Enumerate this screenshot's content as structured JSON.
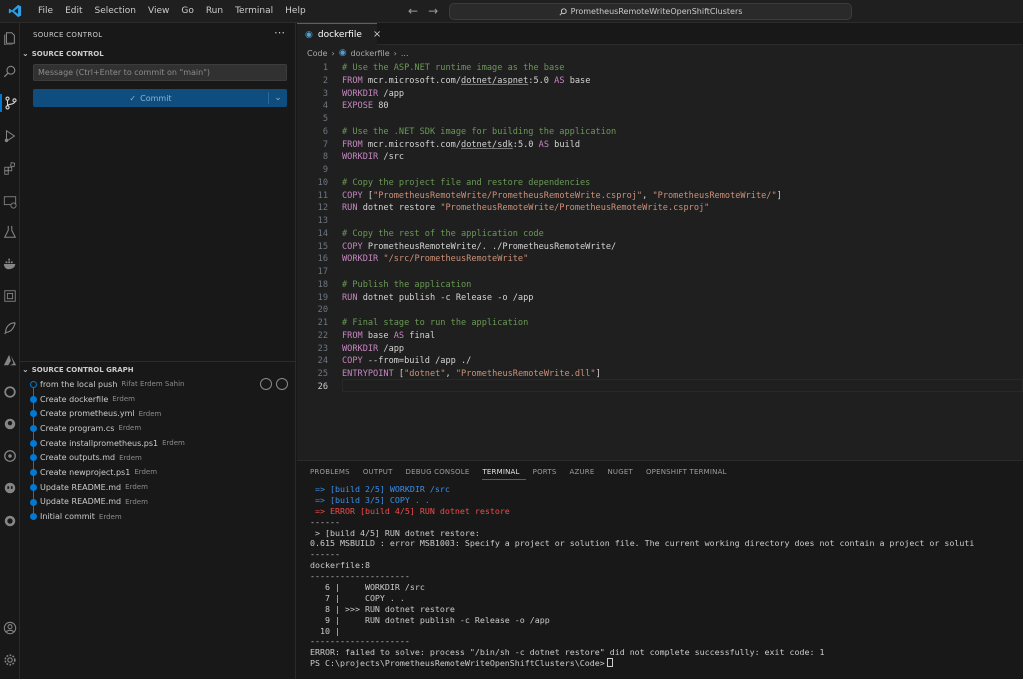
{
  "menu": [
    "File",
    "Edit",
    "Selection",
    "View",
    "Go",
    "Run",
    "Terminal",
    "Help"
  ],
  "command_center": {
    "text": "PrometheusRemoteWriteOpenShiftClusters"
  },
  "sidebar": {
    "title": "SOURCE CONTROL",
    "section": "SOURCE CONTROL",
    "message_placeholder": "Message (Ctrl+Enter to commit on \"main\")",
    "commit_label": "Commit",
    "graph_title": "SOURCE CONTROL GRAPH",
    "graph": [
      {
        "message": "from the local push",
        "author": "Rifat Erdem Sahin"
      },
      {
        "message": "Create dockerfile",
        "author": "Erdem"
      },
      {
        "message": "Create prometheus.yml",
        "author": "Erdem"
      },
      {
        "message": "Create program.cs",
        "author": "Erdem"
      },
      {
        "message": "Create installprometheus.ps1",
        "author": "Erdem"
      },
      {
        "message": "Create outputs.md",
        "author": "Erdem"
      },
      {
        "message": "Create newproject.ps1",
        "author": "Erdem"
      },
      {
        "message": "Update README.md",
        "author": "Erdem"
      },
      {
        "message": "Update README.md",
        "author": "Erdem"
      },
      {
        "message": "Initial commit",
        "author": "Erdem"
      }
    ]
  },
  "editor": {
    "tab_label": "dockerfile",
    "breadcrumb": [
      "Code",
      "dockerfile",
      "..."
    ],
    "lines": [
      {
        "n": "1",
        "parts": [
          [
            "c",
            "# Use the ASP.NET runtime image as the base"
          ]
        ]
      },
      {
        "n": "2",
        "parts": [
          [
            "k",
            "FROM "
          ],
          [
            "t",
            "mcr.microsoft.com/"
          ],
          [
            "u",
            "dotnet/aspnet"
          ],
          [
            "t",
            ":5.0 "
          ],
          [
            "k",
            "AS "
          ],
          [
            "t",
            "base"
          ]
        ]
      },
      {
        "n": "3",
        "parts": [
          [
            "k",
            "WORKDIR "
          ],
          [
            "t",
            "/app"
          ]
        ]
      },
      {
        "n": "4",
        "parts": [
          [
            "k",
            "EXPOSE "
          ],
          [
            "t",
            "80"
          ]
        ]
      },
      {
        "n": "5",
        "parts": []
      },
      {
        "n": "6",
        "parts": [
          [
            "c",
            "# Use the .NET SDK image for building the application"
          ]
        ]
      },
      {
        "n": "7",
        "parts": [
          [
            "k",
            "FROM "
          ],
          [
            "t",
            "mcr.microsoft.com/"
          ],
          [
            "u",
            "dotnet/sdk"
          ],
          [
            "t",
            ":5.0 "
          ],
          [
            "k",
            "AS "
          ],
          [
            "t",
            "build"
          ]
        ]
      },
      {
        "n": "8",
        "parts": [
          [
            "k",
            "WORKDIR "
          ],
          [
            "t",
            "/src"
          ]
        ]
      },
      {
        "n": "9",
        "parts": []
      },
      {
        "n": "10",
        "parts": [
          [
            "c",
            "# Copy the project file and restore dependencies"
          ]
        ]
      },
      {
        "n": "11",
        "parts": [
          [
            "k",
            "COPY "
          ],
          [
            "t",
            "["
          ],
          [
            "s",
            "\"PrometheusRemoteWrite/PrometheusRemoteWrite.csproj\""
          ],
          [
            "t",
            ", "
          ],
          [
            "s",
            "\"PrometheusRemoteWrite/\""
          ],
          [
            "t",
            "]"
          ]
        ]
      },
      {
        "n": "12",
        "parts": [
          [
            "k",
            "RUN "
          ],
          [
            "t",
            "dotnet restore "
          ],
          [
            "s",
            "\"PrometheusRemoteWrite/PrometheusRemoteWrite.csproj\""
          ]
        ]
      },
      {
        "n": "13",
        "parts": []
      },
      {
        "n": "14",
        "parts": [
          [
            "c",
            "# Copy the rest of the application code"
          ]
        ]
      },
      {
        "n": "15",
        "parts": [
          [
            "k",
            "COPY "
          ],
          [
            "t",
            "PrometheusRemoteWrite/. ./PrometheusRemoteWrite/"
          ]
        ]
      },
      {
        "n": "16",
        "parts": [
          [
            "k",
            "WORKDIR "
          ],
          [
            "s",
            "\"/src/PrometheusRemoteWrite\""
          ]
        ]
      },
      {
        "n": "17",
        "parts": []
      },
      {
        "n": "18",
        "parts": [
          [
            "c",
            "# Publish the application"
          ]
        ]
      },
      {
        "n": "19",
        "parts": [
          [
            "k",
            "RUN "
          ],
          [
            "t",
            "dotnet publish -c Release -o /app"
          ]
        ]
      },
      {
        "n": "20",
        "parts": []
      },
      {
        "n": "21",
        "parts": [
          [
            "c",
            "# Final stage to run the application"
          ]
        ]
      },
      {
        "n": "22",
        "parts": [
          [
            "k",
            "FROM "
          ],
          [
            "t",
            "base "
          ],
          [
            "k",
            "AS "
          ],
          [
            "t",
            "final"
          ]
        ]
      },
      {
        "n": "23",
        "parts": [
          [
            "k",
            "WORKDIR "
          ],
          [
            "t",
            "/app"
          ]
        ]
      },
      {
        "n": "24",
        "parts": [
          [
            "k",
            "COPY "
          ],
          [
            "t",
            "--from=build /app ./"
          ]
        ]
      },
      {
        "n": "25",
        "parts": [
          [
            "k",
            "ENTRYPOINT "
          ],
          [
            "t",
            "["
          ],
          [
            "s",
            "\"dotnet\""
          ],
          [
            "t",
            ", "
          ],
          [
            "s",
            "\"PrometheusRemoteWrite.dll\""
          ],
          [
            "t",
            "]"
          ]
        ]
      },
      {
        "n": "26",
        "parts": []
      }
    ]
  },
  "panel": {
    "tabs": [
      "PROBLEMS",
      "OUTPUT",
      "DEBUG CONSOLE",
      "TERMINAL",
      "PORTS",
      "AZURE",
      "NUGET",
      "OPENSHIFT TERMINAL"
    ],
    "active_tab": "TERMINAL",
    "terminal": [
      {
        "style": "blue",
        "text": " => [build 2/5] WORKDIR /src"
      },
      {
        "style": "blue",
        "text": " => [build 3/5] COPY . ."
      },
      {
        "style": "red",
        "text": " => ERROR [build 4/5] RUN dotnet restore"
      },
      {
        "style": "",
        "text": "------"
      },
      {
        "style": "",
        "text": " > [build 4/5] RUN dotnet restore:"
      },
      {
        "style": "",
        "text": "0.615 MSBUILD : error MSB1003: Specify a project or solution file. The current working directory does not contain a project or soluti"
      },
      {
        "style": "",
        "text": "------"
      },
      {
        "style": "",
        "text": "dockerfile:8"
      },
      {
        "style": "",
        "text": "--------------------"
      },
      {
        "style": "",
        "text": "   6 |     WORKDIR /src"
      },
      {
        "style": "",
        "text": "   7 |     COPY . ."
      },
      {
        "style": "",
        "text": "   8 | >>> RUN dotnet restore"
      },
      {
        "style": "",
        "text": "   9 |     RUN dotnet publish -c Release -o /app"
      },
      {
        "style": "",
        "text": "  10 |"
      },
      {
        "style": "",
        "text": "--------------------"
      },
      {
        "style": "",
        "text": "ERROR: failed to solve: process \"/bin/sh -c dotnet restore\" did not complete successfully: exit code: 1"
      },
      {
        "style": "",
        "text": "PS C:\\projects\\PrometheusRemoteWriteOpenShiftClusters\\Code>"
      }
    ]
  }
}
